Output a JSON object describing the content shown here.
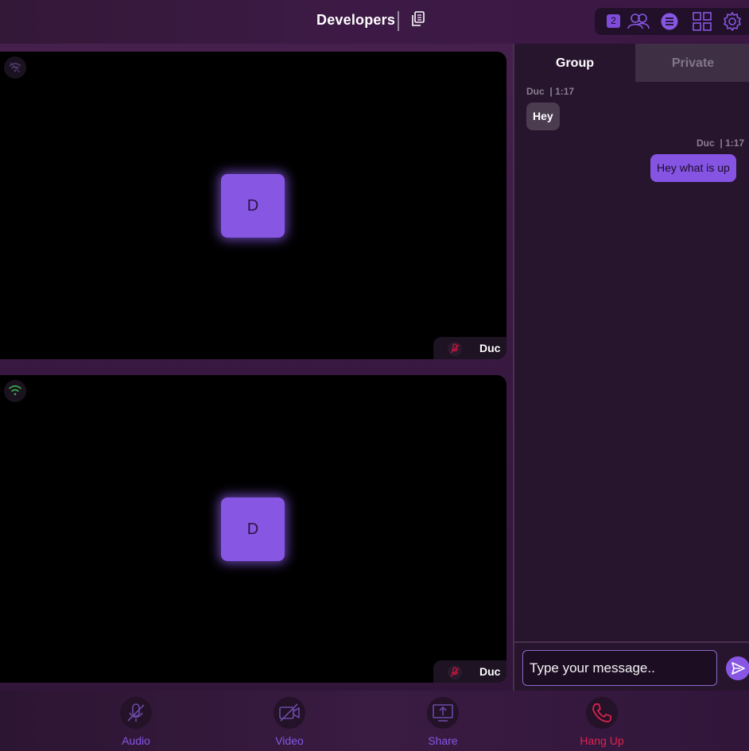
{
  "header": {
    "room_title": "Developers",
    "copy_icon": "copy-icon",
    "participants_count": "2",
    "toolbar_icons": [
      "participants-icon",
      "chat-icon",
      "grid-layout-icon",
      "gear-icon"
    ]
  },
  "tiles": [
    {
      "avatar_letter": "D",
      "name": "Duc",
      "network_icon": "wifi-weak-icon",
      "mic_icon": "mic-off-icon"
    },
    {
      "avatar_letter": "D",
      "name": "Duc",
      "network_icon": "wifi-strong-icon",
      "mic_icon": "mic-off-icon"
    }
  ],
  "chat": {
    "tabs": [
      {
        "label": "Group",
        "active": true
      },
      {
        "label": "Private",
        "active": false
      }
    ],
    "messages": [
      {
        "author": "Duc",
        "time": "1:17",
        "text": "Hey",
        "direction": "incoming"
      },
      {
        "author": "Duc",
        "time": "1:17",
        "text": "Hey what is up",
        "direction": "outgoing"
      }
    ],
    "input_placeholder": "Type your message..",
    "send_icon": "send-icon"
  },
  "controls": [
    {
      "label": "Audio",
      "icon": "mic-off-icon"
    },
    {
      "label": "Video",
      "icon": "video-off-icon"
    },
    {
      "label": "Share",
      "icon": "screen-share-icon"
    },
    {
      "label": "Hang Up",
      "icon": "phone-icon"
    }
  ],
  "colors": {
    "accent": "#8757e4",
    "hangup": "#e0224f",
    "background": "#2a1430",
    "tile": "#000000"
  }
}
